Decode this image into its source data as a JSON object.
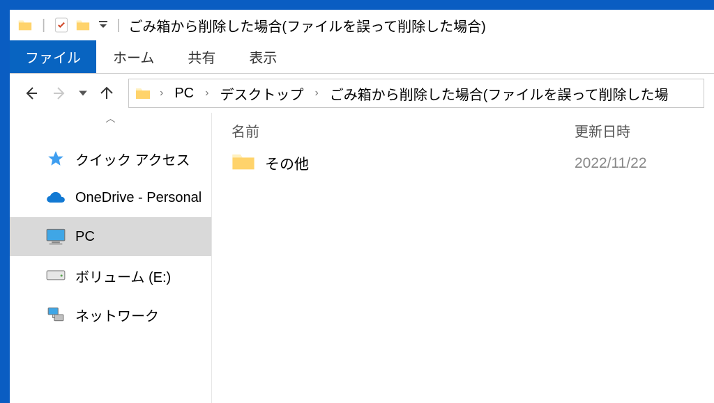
{
  "title": "ごみ箱から削除した場合(ファイルを誤って削除した場合)",
  "ribbon": {
    "file": "ファイル",
    "home": "ホーム",
    "share": "共有",
    "view": "表示"
  },
  "breadcrumb": {
    "seg0": "PC",
    "seg1": "デスクトップ",
    "seg2": "ごみ箱から削除した場合(ファイルを誤って削除した場"
  },
  "tree": {
    "quick_access": "クイック アクセス",
    "onedrive": "OneDrive - Personal",
    "pc": "PC",
    "volume_e": "ボリューム (E:)",
    "network": "ネットワーク"
  },
  "columns": {
    "name": "名前",
    "modified": "更新日時"
  },
  "items": [
    {
      "name": "その他",
      "modified": "2022/11/22"
    }
  ]
}
